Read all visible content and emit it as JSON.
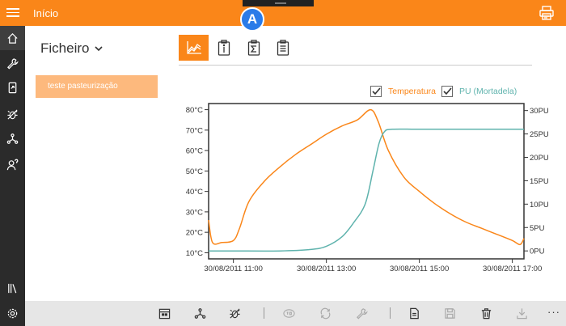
{
  "header": {
    "title": "Início",
    "badge": "A",
    "menu_icon": "hamburger-icon",
    "print_icon": "printer-icon"
  },
  "sidebar": {
    "items": [
      {
        "icon": "home-icon",
        "active": true
      },
      {
        "icon": "wrench-icon"
      },
      {
        "icon": "device-icon"
      },
      {
        "icon": "bug-icon"
      },
      {
        "icon": "network-icon"
      },
      {
        "icon": "user-help-icon"
      },
      {
        "icon": "library-icon"
      },
      {
        "icon": "settings-icon"
      }
    ]
  },
  "file_panel": {
    "dropdown_label": "Ficheiro",
    "files": [
      "teste pasteurização"
    ]
  },
  "tabs": [
    {
      "icon": "chart-line-icon",
      "active": true
    },
    {
      "icon": "info-clipboard-icon"
    },
    {
      "icon": "sum-clipboard-icon"
    },
    {
      "icon": "list-clipboard-icon"
    }
  ],
  "legend": [
    {
      "label": "Temperatura",
      "color": "#fa8619",
      "checked": true
    },
    {
      "label": "PU (Mortadela)",
      "color": "#5fb3ad",
      "checked": true
    }
  ],
  "colors": {
    "accent": "#fa8619",
    "pu": "#5fb3ad"
  },
  "chart_data": {
    "type": "line",
    "x_axis": {
      "ticks": [
        "30/08/2011 11:00",
        "30/08/2011 13:00",
        "30/08/2011 15:00",
        "30/08/2011 17:00"
      ],
      "range": [
        "30/08/2011 10:28",
        "30/08/2011 17:15"
      ]
    },
    "y_left": {
      "ticks": [
        "10°C",
        "20°C",
        "30°C",
        "40°C",
        "50°C",
        "60°C",
        "70°C",
        "80°C"
      ],
      "range": [
        7,
        83
      ],
      "unit": "°C"
    },
    "y_right": {
      "ticks": [
        "0PU",
        "5PU",
        "10PU",
        "15PU",
        "20PU",
        "25PU",
        "30PU"
      ],
      "range": [
        -1.7,
        31.5
      ],
      "unit": "PU"
    },
    "series": [
      {
        "name": "Temperatura",
        "axis": "left",
        "color": "#fa8619",
        "x": [
          "30/08/2011 10:28",
          "30/08/2011 10:33",
          "30/08/2011 10:45",
          "30/08/2011 11:00",
          "30/08/2011 11:08",
          "30/08/2011 11:20",
          "30/08/2011 11:40",
          "30/08/2011 12:00",
          "30/08/2011 12:20",
          "30/08/2011 12:40",
          "30/08/2011 13:00",
          "30/08/2011 13:20",
          "30/08/2011 13:40",
          "30/08/2011 13:57",
          "30/08/2011 14:07",
          "30/08/2011 14:20",
          "30/08/2011 14:40",
          "30/08/2011 15:00",
          "30/08/2011 15:20",
          "30/08/2011 15:40",
          "30/08/2011 16:00",
          "30/08/2011 16:20",
          "30/08/2011 16:40",
          "30/08/2011 17:00",
          "30/08/2011 17:10",
          "30/08/2011 17:15"
        ],
        "y": [
          26,
          15,
          15,
          16,
          22,
          35,
          45,
          52,
          58,
          63,
          68,
          72,
          75,
          80,
          74,
          60,
          47,
          40,
          34,
          29,
          25,
          22,
          19,
          16,
          14,
          17
        ]
      },
      {
        "name": "PU (Mortadela)",
        "axis": "right",
        "color": "#5fb3ad",
        "x": [
          "30/08/2011 10:28",
          "30/08/2011 11:00",
          "30/08/2011 12:00",
          "30/08/2011 12:40",
          "30/08/2011 13:00",
          "30/08/2011 13:20",
          "30/08/2011 13:35",
          "30/08/2011 13:50",
          "30/08/2011 14:00",
          "30/08/2011 14:08",
          "30/08/2011 14:15",
          "30/08/2011 14:25",
          "30/08/2011 15:00",
          "30/08/2011 16:00",
          "30/08/2011 17:15"
        ],
        "y": [
          0,
          0,
          0,
          0.3,
          1,
          3,
          6,
          10,
          17,
          23,
          25.5,
          26,
          26,
          26,
          26
        ]
      }
    ]
  }
}
